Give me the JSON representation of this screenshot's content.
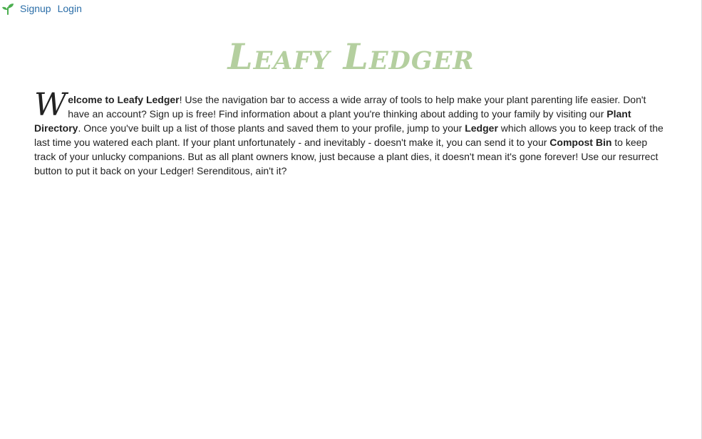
{
  "nav": {
    "logo_icon": "sprout-icon",
    "signup_label": "Signup",
    "login_label": "Login"
  },
  "title": "Leafy Ledger",
  "intro": {
    "dropcap": "W",
    "welcome_bold": "elcome to Leafy Ledger",
    "text1": "! Use the navigation bar to access a wide array of tools to help make your plant parenting life easier. Don't have an account? Sign up is free! Find information about a plant you're thinking about adding to your family by visiting our ",
    "plant_directory": "Plant Directory",
    "text2": ". Once you've built up a list of those plants and saved them to your profile, jump to your ",
    "ledger": "Ledger",
    "text3": " which allows you to keep track of the last time you watered each plant. If your plant unfortunately - and inevitably - doesn't make it, you can send it to your ",
    "compost_bin": "Compost Bin",
    "text4": " to keep track of your unlucky companions. But as all plant owners know, just because a plant dies, it doesn't mean it's gone forever! Use our resurrect button to put it back on your Ledger! Serenditous, ain't it?"
  },
  "colors": {
    "title": "#b4cf9f",
    "link": "#2b6ea8",
    "logo": "#4caf50"
  }
}
